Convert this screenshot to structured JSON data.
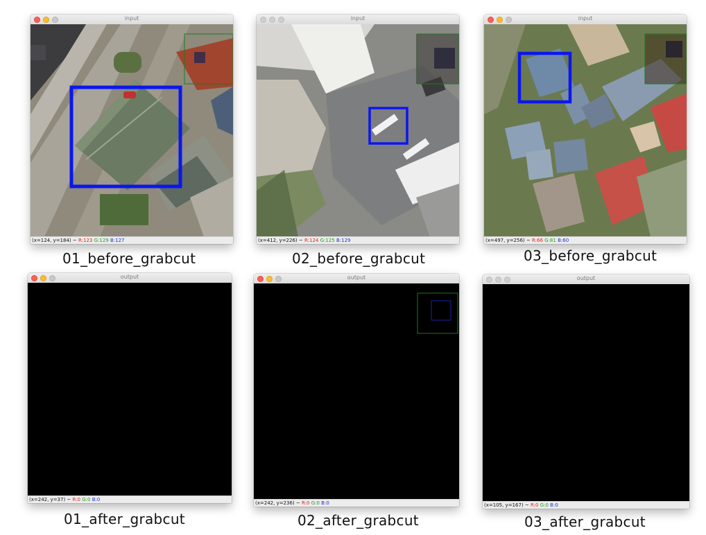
{
  "panels": [
    {
      "id": "p1",
      "window_title": "input",
      "caption": "01_before_grabcut",
      "status": {
        "coords": "(x=124, y=184) ~",
        "r": "R:123",
        "g": "G:129",
        "b": "B:127"
      }
    },
    {
      "id": "p2",
      "window_title": "input",
      "caption": "02_before_grabcut",
      "status": {
        "coords": "(x=412, y=226) ~",
        "r": "R:124",
        "g": "G:125",
        "b": "B:129"
      }
    },
    {
      "id": "p3",
      "window_title": "input",
      "caption": "03_before_grabcut",
      "status": {
        "coords": "(x=497, y=256) ~",
        "r": "R:66",
        "g": "G:81",
        "b": "B:60"
      }
    },
    {
      "id": "p4",
      "window_title": "output",
      "caption": "01_after_grabcut",
      "status": {
        "coords": "(x=242, y=37) ~",
        "r": "R:0",
        "g": "G:0",
        "b": "B:0"
      }
    },
    {
      "id": "p5",
      "window_title": "output",
      "caption": "02_after_grabcut",
      "status": {
        "coords": "(x=242, y=236) ~",
        "r": "R:0",
        "g": "G:0",
        "b": "B:0"
      }
    },
    {
      "id": "p6",
      "window_title": "output",
      "caption": "03_after_grabcut",
      "status": {
        "coords": "(x=105, y=167) ~",
        "r": "R:0",
        "g": "G:0",
        "b": "B:0"
      }
    }
  ],
  "colors": {
    "selection_box": "#0b16f0",
    "overlay_box": "#1f7a1f",
    "status_r": "#e0221b",
    "status_g": "#1f9a1f",
    "status_b": "#1b2fd0"
  }
}
